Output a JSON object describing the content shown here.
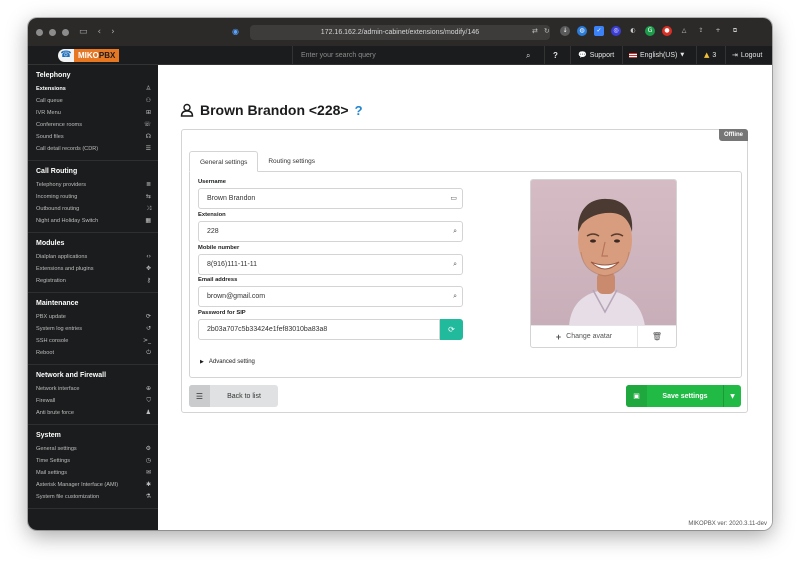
{
  "browser": {
    "url": "172.16.162.2/admin-cabinet/extensions/modify/146"
  },
  "header": {
    "logo_text_a": "MIKO",
    "logo_text_b": "PBX",
    "search_placeholder": "Enter your search query",
    "help_label": "?",
    "support_label": "Support",
    "language_label": "English(US)",
    "notifications_count": "3",
    "logout_label": "Logout"
  },
  "sidebar": {
    "sections": [
      {
        "title": "Telephony",
        "items": [
          {
            "label": "Extensions",
            "icon": "user-icon",
            "glyph": "♙",
            "active": true
          },
          {
            "label": "Call queue",
            "icon": "users-icon",
            "glyph": "⚇"
          },
          {
            "label": "IVR Menu",
            "icon": "sitemap-icon",
            "glyph": "⊞"
          },
          {
            "label": "Conference rooms",
            "icon": "phone-volume-icon",
            "glyph": "☏"
          },
          {
            "label": "Sound files",
            "icon": "headphones-icon",
            "glyph": "☊"
          },
          {
            "label": "Call detail records (CDR)",
            "icon": "list-icon",
            "glyph": "☰"
          }
        ]
      },
      {
        "title": "Call Routing",
        "items": [
          {
            "label": "Telephony providers",
            "icon": "server-icon",
            "glyph": "≣"
          },
          {
            "label": "Incoming routing",
            "icon": "route-icon",
            "glyph": "⇆"
          },
          {
            "label": "Outbound routing",
            "icon": "random-icon",
            "glyph": "⤨"
          },
          {
            "label": "Night and Holiday Switch",
            "icon": "calendar-icon",
            "glyph": "▦"
          }
        ]
      },
      {
        "title": "Modules",
        "items": [
          {
            "label": "Dialplan applications",
            "icon": "code-icon",
            "glyph": "‹›"
          },
          {
            "label": "Extensions and plugins",
            "icon": "puzzle-icon",
            "glyph": "✥"
          },
          {
            "label": "Registration",
            "icon": "key-icon",
            "glyph": "⚷"
          }
        ]
      },
      {
        "title": "Maintenance",
        "items": [
          {
            "label": "PBX update",
            "icon": "sync-icon",
            "glyph": "⟳"
          },
          {
            "label": "System log entries",
            "icon": "history-icon",
            "glyph": "↺"
          },
          {
            "label": "SSH console",
            "icon": "terminal-icon",
            "glyph": ">_"
          },
          {
            "label": "Reboot",
            "icon": "power-icon",
            "glyph": "⏻"
          }
        ]
      },
      {
        "title": "Network and Firewall",
        "items": [
          {
            "label": "Network interface",
            "icon": "globe-icon",
            "glyph": "⊕"
          },
          {
            "label": "Firewall",
            "icon": "shield-icon",
            "glyph": "⛉"
          },
          {
            "label": "Anti brute force",
            "icon": "user-secret-icon",
            "glyph": "♟"
          }
        ]
      },
      {
        "title": "System",
        "items": [
          {
            "label": "General settings",
            "icon": "cogs-icon",
            "glyph": "⚙"
          },
          {
            "label": "Time Settings",
            "icon": "clock-icon",
            "glyph": "◷"
          },
          {
            "label": "Mail settings",
            "icon": "envelope-icon",
            "glyph": "✉"
          },
          {
            "label": "Asterisk Manager Interface (AMI)",
            "icon": "asterisk-icon",
            "glyph": "✱"
          },
          {
            "label": "System file customization",
            "icon": "flask-icon",
            "glyph": "⚗"
          }
        ]
      }
    ]
  },
  "page": {
    "title": "Brown Brandon <228>",
    "help": "?",
    "status": "Offline",
    "tabs": [
      {
        "label": "General settings",
        "active": true
      },
      {
        "label": "Routing settings",
        "active": false
      }
    ],
    "fields": {
      "username": {
        "label": "Username",
        "value": "Brown Brandon"
      },
      "extension": {
        "label": "Extension",
        "value": "228"
      },
      "mobile": {
        "label": "Mobile number",
        "value": "8(916)111-11-11"
      },
      "email": {
        "label": "Email address",
        "value": "brown@gmail.com"
      },
      "sip_password": {
        "label": "Password for SIP",
        "value": "2b03a707c5b33424e1fef83010ba83a8"
      }
    },
    "advanced_label": "Advanced setting",
    "change_avatar_label": "Change avatar",
    "back_label": "Back to list",
    "save_label": "Save settings",
    "version": "MIKOPBX ver: 2020.3.11-dev"
  },
  "colors": {
    "sidebar_bg": "#1b1c1d",
    "accent_orange": "#e87722",
    "save_green": "#21ba45",
    "regen_teal": "#21ba9d",
    "help_blue": "#2185d0",
    "status_grey": "#767676"
  }
}
